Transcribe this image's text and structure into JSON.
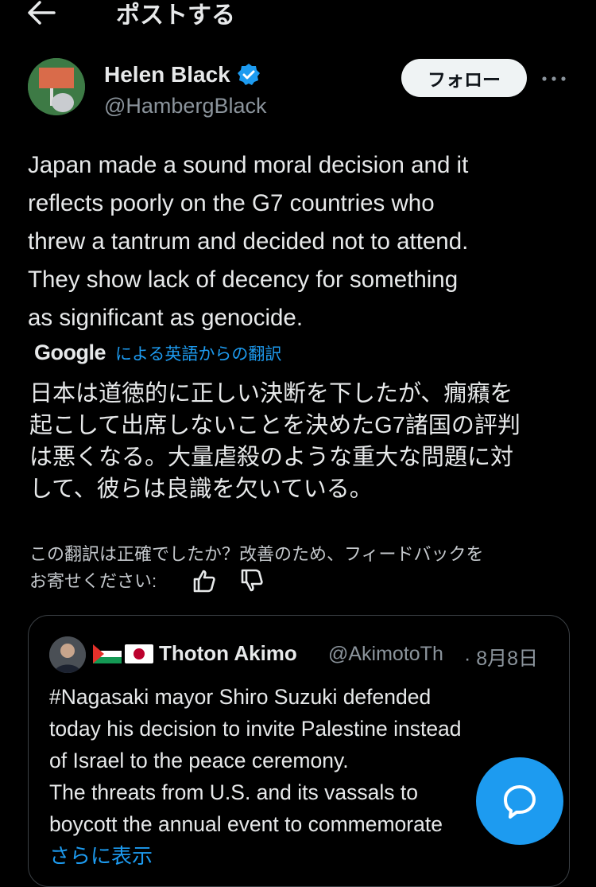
{
  "header": {
    "title": "ポストする",
    "back_icon": "arrow-left-icon"
  },
  "author": {
    "name": "Helen Black",
    "handle": "@HambergBlack",
    "verified_icon": "verified-badge-icon",
    "follow_label": "フォロー",
    "more_icon": "more-horizontal-icon"
  },
  "post": {
    "text": "Japan made a sound moral decision and it\nreflects poorly on the G7 countries who\nthrew a tantrum and decided not to attend.\nThey show  lack of decency for something\nas significant as genocide."
  },
  "translation": {
    "provider": "Google",
    "label": "による英語からの翻訳",
    "text": "日本は道徳的に正しい決断を下したが、癇癪を\n起こして出席しないことを決めたG7諸国の評判\nは悪くなる。大量虐殺のような重大な問題に対\nして、彼らは良識を欠いている。",
    "feedback_prompt": "この翻訳は正確でしたか？改善のため、フィードバックを\nお寄せください:"
  },
  "quote": {
    "name": "Thoton Akimo",
    "handle": "@AkimotoTh",
    "date": "· 8月8日",
    "text": "#Nagasaki mayor Shiro Suzuki defended\ntoday his decision to invite Palestine instead\nof Israel to the peace ceremony.\nThe threats from U.S. and its vassals to\nboycott the annual event to commemorate",
    "show_more": "さらに表示"
  },
  "colors": {
    "background": "#000000",
    "text": "#e7e9ea",
    "muted": "#8b949c",
    "accent": "#1d9bf0",
    "follow_bg": "#eff3f4"
  }
}
